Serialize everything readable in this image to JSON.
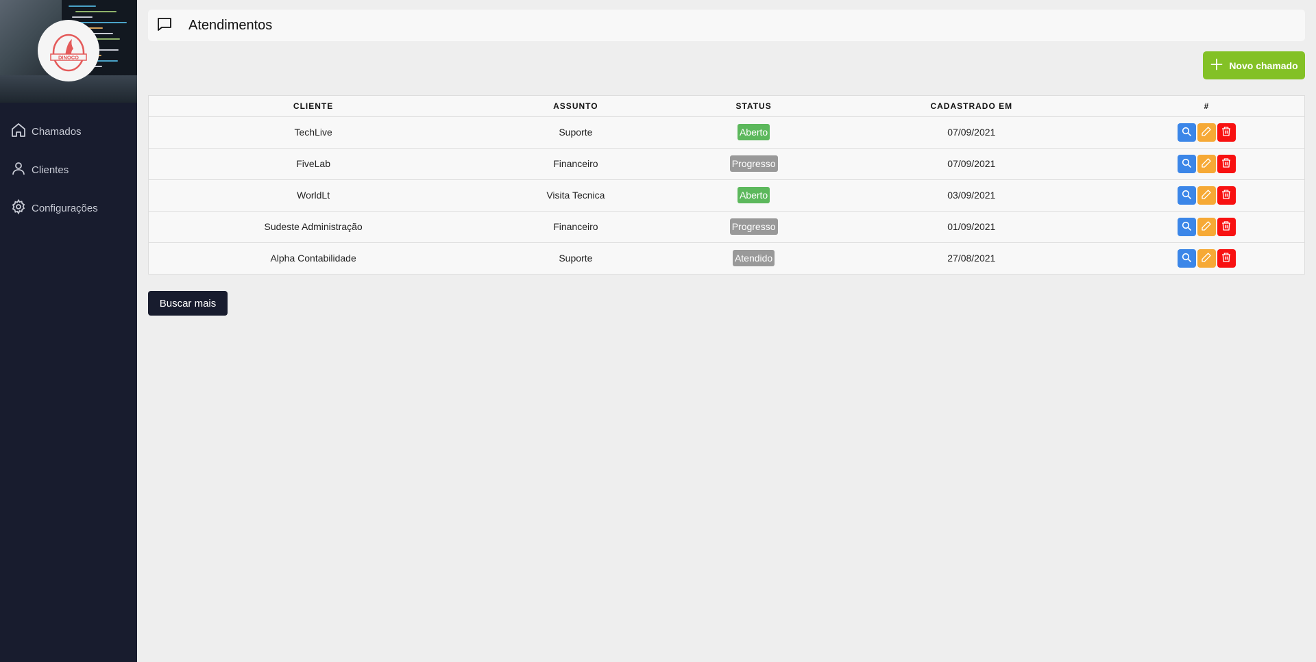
{
  "sidebar": {
    "logo_text": "DINOCO",
    "items": [
      {
        "label": "Chamados",
        "icon": "home-icon"
      },
      {
        "label": "Clientes",
        "icon": "user-icon"
      },
      {
        "label": "Configurações",
        "icon": "gear-icon"
      }
    ]
  },
  "header": {
    "title": "Atendimentos",
    "icon": "message-icon"
  },
  "toolbar": {
    "new_label": "Novo chamado"
  },
  "table": {
    "columns": [
      "CLIENTE",
      "ASSUNTO",
      "STATUS",
      "CADASTRADO EM",
      "#"
    ],
    "rows": [
      {
        "cliente": "TechLive",
        "assunto": "Suporte",
        "status": "Aberto",
        "data": "07/09/2021"
      },
      {
        "cliente": "FiveLab",
        "assunto": "Financeiro",
        "status": "Progresso",
        "data": "07/09/2021"
      },
      {
        "cliente": "WorldLt",
        "assunto": "Visita Tecnica",
        "status": "Aberto",
        "data": "03/09/2021"
      },
      {
        "cliente": "Sudeste Administração",
        "assunto": "Financeiro",
        "status": "Progresso",
        "data": "01/09/2021"
      },
      {
        "cliente": "Alpha Contabilidade",
        "assunto": "Suporte",
        "status": "Atendido",
        "data": "27/08/2021"
      }
    ]
  },
  "status_colors": {
    "Aberto": "#5cb85c",
    "Progresso": "#999999",
    "Atendido": "#999999"
  },
  "action_colors": {
    "view": "#3b86e8",
    "edit": "#f6a935",
    "delete": "#f81111"
  },
  "footer": {
    "more_label": "Buscar mais"
  }
}
